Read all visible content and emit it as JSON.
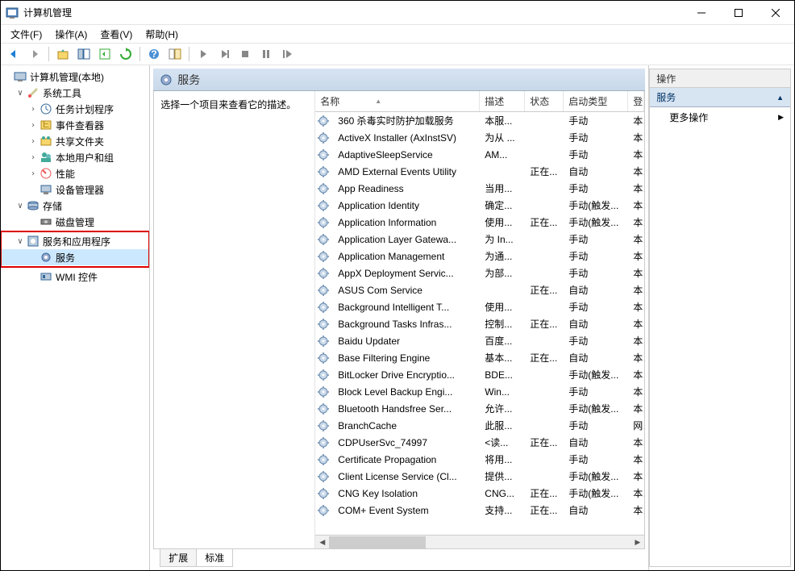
{
  "window": {
    "title": "计算机管理"
  },
  "menu": {
    "file": "文件(F)",
    "action": "操作(A)",
    "view": "查看(V)",
    "help": "帮助(H)"
  },
  "tree": {
    "root": "计算机管理(本地)",
    "system_tools": "系统工具",
    "task_scheduler": "任务计划程序",
    "event_viewer": "事件查看器",
    "shared_folders": "共享文件夹",
    "local_users": "本地用户和组",
    "performance": "性能",
    "device_manager": "设备管理器",
    "storage": "存储",
    "disk_management": "磁盘管理",
    "services_apps": "服务和应用程序",
    "services": "服务",
    "wmi": "WMI 控件"
  },
  "mid": {
    "header": "服务",
    "desc_prompt": "选择一个项目来查看它的描述。",
    "cols": {
      "name": "名称",
      "desc": "描述",
      "status": "状态",
      "startup": "启动类型",
      "logon": "登"
    }
  },
  "tabs": {
    "extended": "扩展",
    "standard": "标准"
  },
  "actions": {
    "header": "操作",
    "section": "服务",
    "more": "更多操作"
  },
  "services": [
    {
      "name": "360 杀毒实时防护加载服务",
      "desc": "本服...",
      "status": "",
      "startup": "手动",
      "logon": "本"
    },
    {
      "name": "ActiveX Installer (AxInstSV)",
      "desc": "为从 ...",
      "status": "",
      "startup": "手动",
      "logon": "本"
    },
    {
      "name": "AdaptiveSleepService",
      "desc": "AM...",
      "status": "",
      "startup": "手动",
      "logon": "本"
    },
    {
      "name": "AMD External Events Utility",
      "desc": "",
      "status": "正在...",
      "startup": "自动",
      "logon": "本"
    },
    {
      "name": "App Readiness",
      "desc": "当用...",
      "status": "",
      "startup": "手动",
      "logon": "本"
    },
    {
      "name": "Application Identity",
      "desc": "确定...",
      "status": "",
      "startup": "手动(触发...",
      "logon": "本"
    },
    {
      "name": "Application Information",
      "desc": "使用...",
      "status": "正在...",
      "startup": "手动(触发...",
      "logon": "本"
    },
    {
      "name": "Application Layer Gatewa...",
      "desc": "为 In...",
      "status": "",
      "startup": "手动",
      "logon": "本"
    },
    {
      "name": "Application Management",
      "desc": "为通...",
      "status": "",
      "startup": "手动",
      "logon": "本"
    },
    {
      "name": "AppX Deployment Servic...",
      "desc": "为部...",
      "status": "",
      "startup": "手动",
      "logon": "本"
    },
    {
      "name": "ASUS Com Service",
      "desc": "",
      "status": "正在...",
      "startup": "自动",
      "logon": "本"
    },
    {
      "name": "Background Intelligent T...",
      "desc": "使用...",
      "status": "",
      "startup": "手动",
      "logon": "本"
    },
    {
      "name": "Background Tasks Infras...",
      "desc": "控制...",
      "status": "正在...",
      "startup": "自动",
      "logon": "本"
    },
    {
      "name": "Baidu Updater",
      "desc": "百度...",
      "status": "",
      "startup": "手动",
      "logon": "本"
    },
    {
      "name": "Base Filtering Engine",
      "desc": "基本...",
      "status": "正在...",
      "startup": "自动",
      "logon": "本"
    },
    {
      "name": "BitLocker Drive Encryptio...",
      "desc": "BDE...",
      "status": "",
      "startup": "手动(触发...",
      "logon": "本"
    },
    {
      "name": "Block Level Backup Engi...",
      "desc": "Win...",
      "status": "",
      "startup": "手动",
      "logon": "本"
    },
    {
      "name": "Bluetooth Handsfree Ser...",
      "desc": "允许...",
      "status": "",
      "startup": "手动(触发...",
      "logon": "本"
    },
    {
      "name": "BranchCache",
      "desc": "此服...",
      "status": "",
      "startup": "手动",
      "logon": "网"
    },
    {
      "name": "CDPUserSvc_74997",
      "desc": "<读...",
      "status": "正在...",
      "startup": "自动",
      "logon": "本"
    },
    {
      "name": "Certificate Propagation",
      "desc": "将用...",
      "status": "",
      "startup": "手动",
      "logon": "本"
    },
    {
      "name": "Client License Service (Cl...",
      "desc": "提供...",
      "status": "",
      "startup": "手动(触发...",
      "logon": "本"
    },
    {
      "name": "CNG Key Isolation",
      "desc": "CNG...",
      "status": "正在...",
      "startup": "手动(触发...",
      "logon": "本"
    },
    {
      "name": "COM+ Event System",
      "desc": "支持...",
      "status": "正在...",
      "startup": "自动",
      "logon": "本"
    }
  ]
}
